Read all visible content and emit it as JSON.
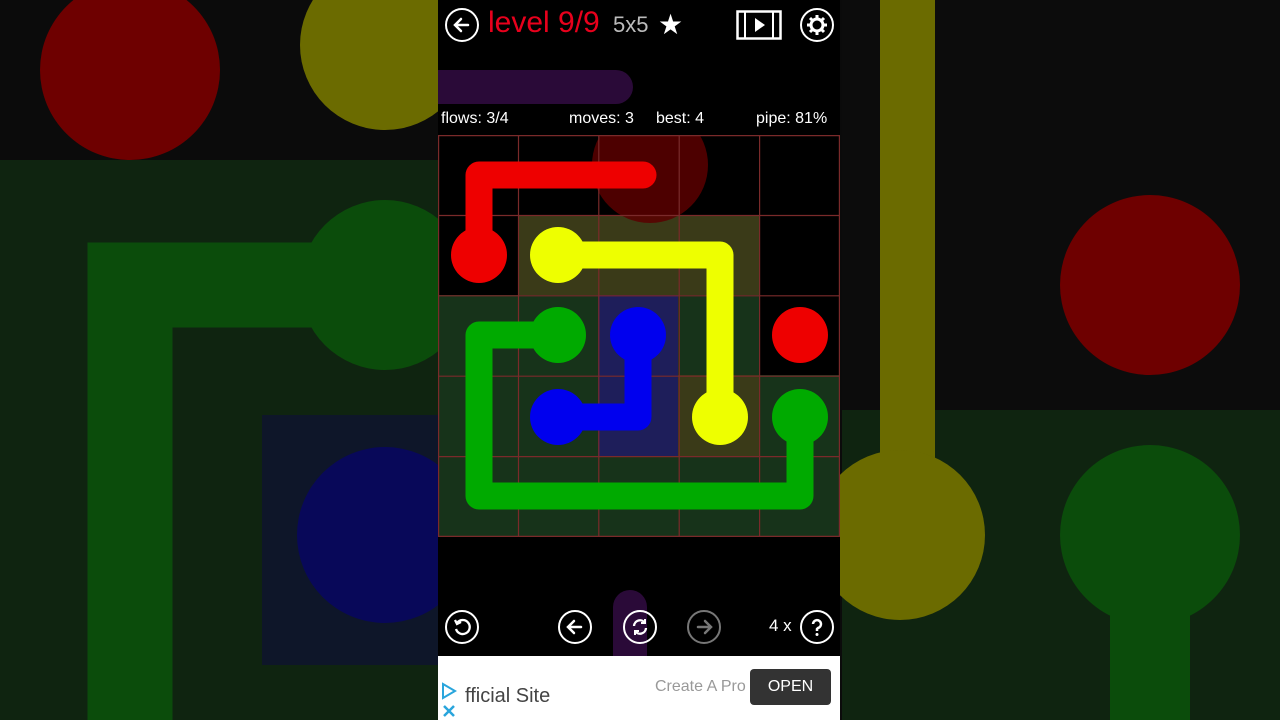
{
  "header": {
    "level_label": "level 9/9",
    "size_label": "5x5",
    "star": "★"
  },
  "stats": {
    "flows": "flows: 3/4",
    "moves": "moves: 3",
    "best": "best: 4",
    "pipe": "pipe: 81%"
  },
  "colors": {
    "red": "#ee0000",
    "yellow": "#eeff00",
    "green": "#00aa00",
    "blue": "#0000ee",
    "grid": "#7a2a2a"
  },
  "board": {
    "rows": 5,
    "cols": 5
  },
  "bottom": {
    "hints_label": "4 x"
  },
  "ad": {
    "title": "fficial Site",
    "subtitle": "Create A Pro",
    "open_label": "OPEN"
  }
}
